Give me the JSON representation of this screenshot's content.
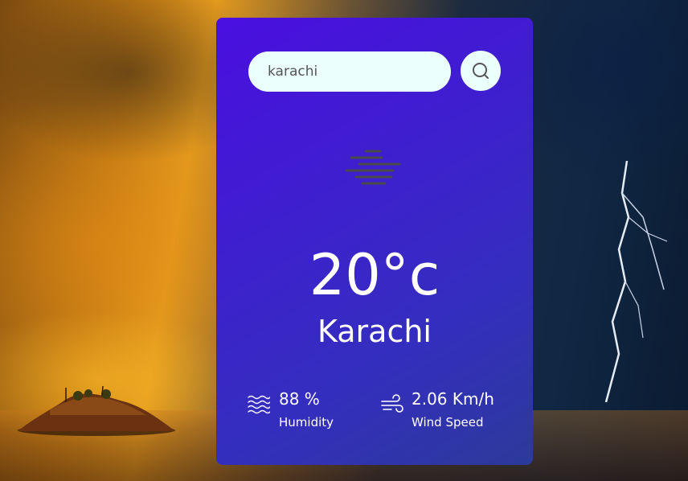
{
  "search": {
    "value": "karachi"
  },
  "weather": {
    "condition_icon": "mist-icon",
    "temperature": "20°c",
    "city": "Karachi"
  },
  "details": {
    "humidity": {
      "value": "88 %",
      "label": "Humidity",
      "icon": "humidity-icon"
    },
    "wind": {
      "value": "2.06 Km/h",
      "label": "Wind Speed",
      "icon": "wind-icon"
    }
  },
  "colors": {
    "card_top": "#4a0fe0",
    "card_bottom": "#2c3a9a",
    "input_bg": "#ebfffc",
    "text": "#ffffff"
  }
}
